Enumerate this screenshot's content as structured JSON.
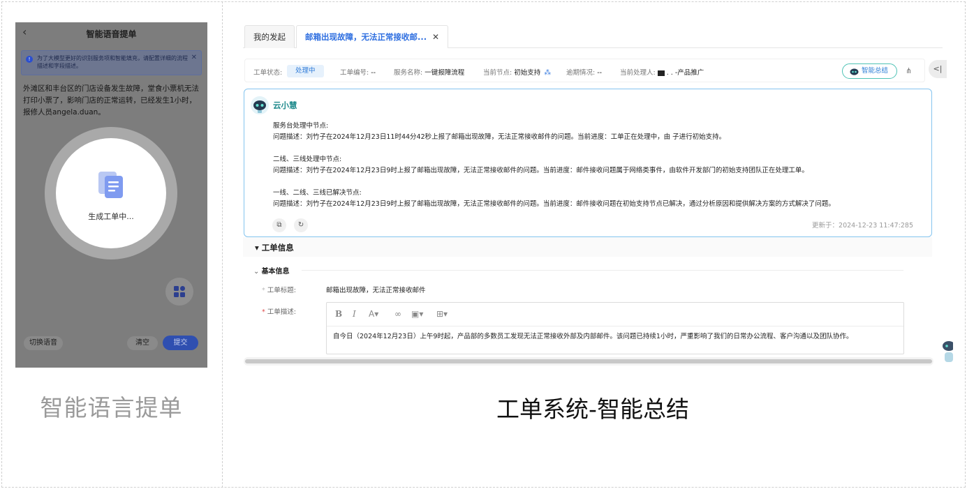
{
  "left_panel": {
    "title": "智能语音提单",
    "notice": "为了大模型更好的识别服务项和智能填充，请配置详细的流程描述和字段描述。",
    "body_text": "外滩区和丰台区的门店设备发生故障，堂食小票机无法打印小票了，影响门店的正常运转，已经发生1小时，报修人员angela.duan。",
    "generating_label": "生成工单中...",
    "switch_voice_label": "切换语音",
    "clear_label": "清空",
    "submit_label": "提交",
    "caption": "智能语言提单"
  },
  "right_panel": {
    "tabs": [
      {
        "label": "我的发起"
      },
      {
        "label": "邮箱出现故障，无法正常接收邮..."
      }
    ],
    "status": {
      "state_label": "工单状态:",
      "state_value": "处理中",
      "number_label": "工单编号:",
      "number_value": "--",
      "service_label": "服务名称:",
      "service_value": "一键报障流程",
      "node_label": "当前节点:",
      "node_value": "初始支持",
      "overdue_label": "逾期情况:",
      "overdue_value": "--",
      "handler_label": "当前处理人:",
      "handler_value": "  . . -产品推广"
    },
    "summary_button": "智能总结",
    "ai": {
      "name": "云小慧",
      "sections": [
        {
          "heading": "服务台处理中节点:",
          "text": "问题描述：刘竹子在2024年12月23日11时44分42秒上报了邮箱出现故障，无法正常接收邮件的问题。当前进度：工单正在处理中，由    子进行初始支持。"
        },
        {
          "heading": "二线、三线处理中节点:",
          "text": "问题描述：刘竹子在2024年12月23日9时上报了邮箱出现故障，无法正常接收邮件的问题。当前进度：邮件接收问题属于网络类事件，由软件开发部门的初始支持团队正在处理工单。"
        },
        {
          "heading": "一线、二线、三线已解决节点:",
          "text": "问题描述：刘竹子在2024年12月23日9时上报了邮箱出现故障，无法正常接收邮件的问题。当前进度：邮件接收问题在初始支持节点已解决，通过分析原因和提供解决方案的方式解决了问题。"
        }
      ],
      "updated": "更新于：2024-12-23 11:47:285"
    },
    "section_title": "工单信息",
    "subsection_title": "基本信息",
    "field_title_label": "工单标题:",
    "field_title_value": "邮箱出现故障，无法正常接收邮件",
    "field_desc_label": "工单描述:",
    "editor_text": "自今日（2024年12月23日）上午9时起，产品部的多数员工发现无法正常接收外部及内部邮件。该问题已持续1小时，严重影响了我们的日常办公流程、客户沟通以及团队协作。",
    "caption": "工单系统-智能总结"
  }
}
